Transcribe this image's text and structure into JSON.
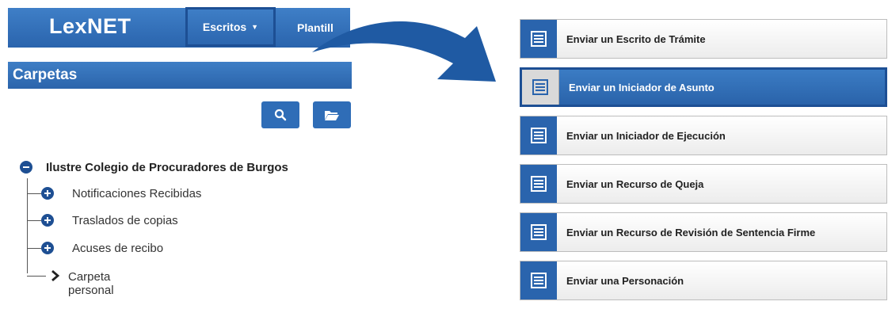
{
  "header": {
    "logo_text": "LexNET",
    "nav_escritos": "Escritos",
    "nav_plantillas": "Plantill"
  },
  "sidebar": {
    "title": "Carpetas",
    "root": "Ilustre Colegio de Procuradores de Burgos",
    "children": [
      {
        "label": "Notificaciones Recibidas"
      },
      {
        "label": "Traslados de copias"
      },
      {
        "label": "Acuses de recibo"
      }
    ],
    "personal": "Carpeta personal"
  },
  "menu": {
    "items": [
      {
        "label": "Enviar un Escrito de Trámite"
      },
      {
        "label": "Enviar un Iniciador de Asunto",
        "active": true
      },
      {
        "label": "Enviar un Iniciador de Ejecución"
      },
      {
        "label": "Enviar un Recurso de Queja"
      },
      {
        "label": "Enviar un Recurso de Revisión de Sentencia Firme"
      },
      {
        "label": "Enviar una Personación"
      }
    ]
  },
  "colors": {
    "primary": "#2a64ad",
    "dark_border": "#1d4f94"
  }
}
